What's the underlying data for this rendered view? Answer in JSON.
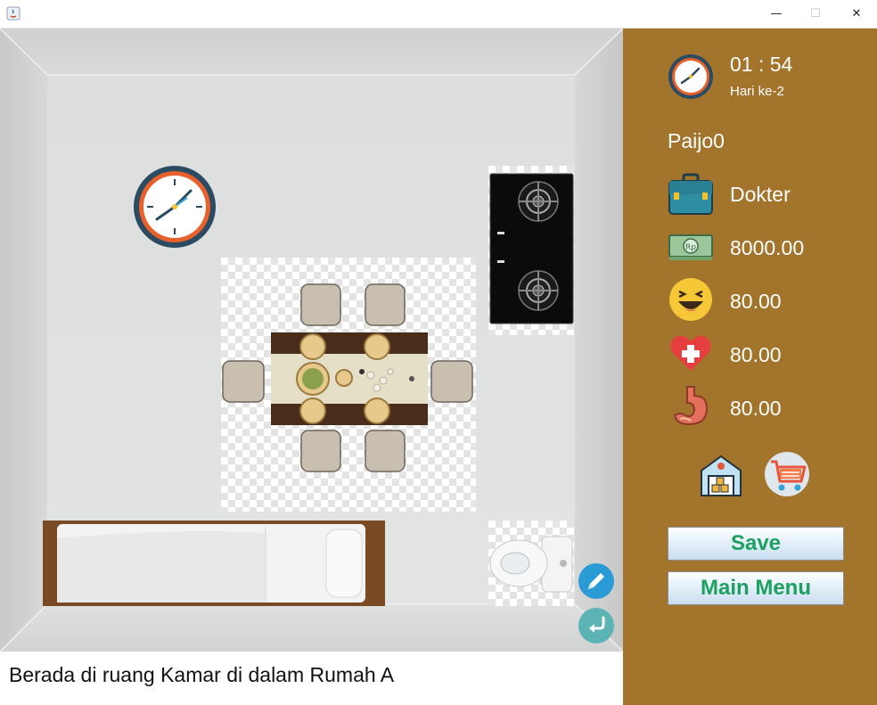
{
  "window": {
    "minimize": "—",
    "maximize": "☐",
    "close": "✕"
  },
  "room": {
    "location_text": "Berada di ruang Kamar di dalam Rumah A"
  },
  "sidebar": {
    "time": "01 : 54",
    "day": "Hari ke-2",
    "player_name": "Paijo0",
    "job": "Dokter",
    "money": "8000.00",
    "happiness": "80.00",
    "health": "80.00",
    "hunger": "80.00",
    "save_label": "Save",
    "main_menu_label": "Main Menu"
  },
  "colors": {
    "panel_bg": "#a3752c",
    "button_text": "#1fa060",
    "edit_button": "#2b9bd6",
    "back_button": "#5cb3b3"
  }
}
